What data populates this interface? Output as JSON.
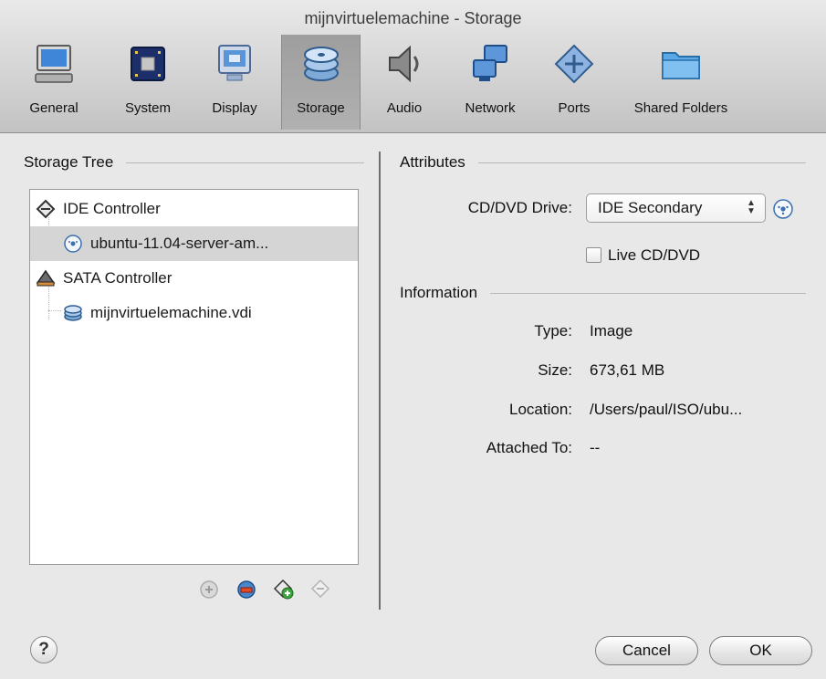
{
  "window": {
    "title": "mijnvirtuelemachine - Storage"
  },
  "toolbar": {
    "items": [
      {
        "label": "General",
        "icon": "computer-icon"
      },
      {
        "label": "System",
        "icon": "motherboard-icon"
      },
      {
        "label": "Display",
        "icon": "monitor-icon"
      },
      {
        "label": "Storage",
        "icon": "storage-disks-icon",
        "selected": true
      },
      {
        "label": "Audio",
        "icon": "speaker-icon"
      },
      {
        "label": "Network",
        "icon": "network-icon"
      },
      {
        "label": "Ports",
        "icon": "ports-icon"
      },
      {
        "label": "Shared Folders",
        "icon": "folder-icon"
      }
    ]
  },
  "storage_tree": {
    "header": "Storage Tree",
    "items": [
      {
        "label": "IDE Controller",
        "icon": "ide-controller-icon",
        "level": 0
      },
      {
        "label": "ubuntu-11.04-server-am...",
        "icon": "cd-dvd-icon",
        "level": 1,
        "selected": true
      },
      {
        "label": "SATA Controller",
        "icon": "sata-controller-icon",
        "level": 0
      },
      {
        "label": "mijnvirtuelemachine.vdi",
        "icon": "hard-disk-icon",
        "level": 1
      }
    ],
    "tools": [
      "add-controller-icon",
      "remove-controller-icon",
      "add-attachment-icon",
      "remove-attachment-icon"
    ]
  },
  "attributes": {
    "header": "Attributes",
    "cd_dvd_drive_label": "CD/DVD Drive:",
    "cd_dvd_drive_value": "IDE Secondary",
    "live_cd_label": "Live CD/DVD",
    "live_cd_checked": false
  },
  "information": {
    "header": "Information",
    "type_label": "Type:",
    "type_value": "Image",
    "size_label": "Size:",
    "size_value": "673,61 MB",
    "location_label": "Location:",
    "location_value": "/Users/paul/ISO/ubu...",
    "attached_label": "Attached To:",
    "attached_value": "--"
  },
  "footer": {
    "help_label": "?",
    "cancel_label": "Cancel",
    "ok_label": "OK"
  }
}
